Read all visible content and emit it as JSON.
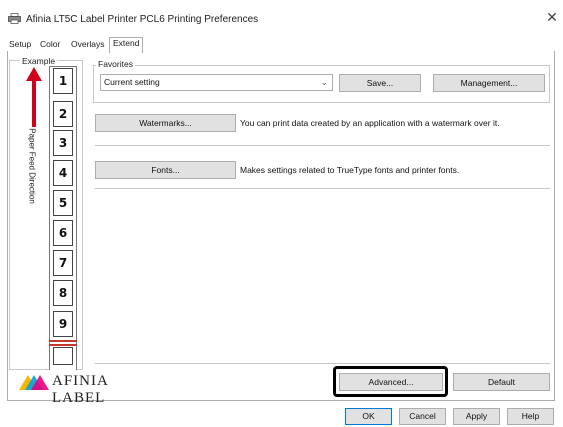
{
  "window": {
    "title": "Afinia LT5C Label Printer PCL6 Printing Preferences",
    "close_glyph": "✕"
  },
  "tabs": [
    {
      "label": "Setup",
      "active": false
    },
    {
      "label": "Color",
      "active": false
    },
    {
      "label": "Overlays",
      "active": false
    },
    {
      "label": "Extend",
      "active": true
    }
  ],
  "example": {
    "label": "Example",
    "feed_direction": "Paper Feed Direction",
    "arrow_color": "#d0021b",
    "labels": [
      "1",
      "2",
      "3",
      "4",
      "5",
      "6",
      "7",
      "8",
      "9"
    ]
  },
  "favorites": {
    "group_label": "Favorites",
    "current_value": "Current setting",
    "save_button": "Save...",
    "management_button": "Management..."
  },
  "watermarks": {
    "button": "Watermarks...",
    "description": "You can print data created by an application with a watermark over it."
  },
  "fonts": {
    "button": "Fonts...",
    "description": "Makes settings related to TrueType fonts and printer fonts."
  },
  "logo": {
    "text": "AFINIA LABEL",
    "colors": [
      "#f7b500",
      "#00a3e0",
      "#e5007e"
    ]
  },
  "advanced_button": "Advanced...",
  "default_button": "Default",
  "footer": {
    "ok": "OK",
    "cancel": "Cancel",
    "apply": "Apply",
    "help": "Help"
  }
}
